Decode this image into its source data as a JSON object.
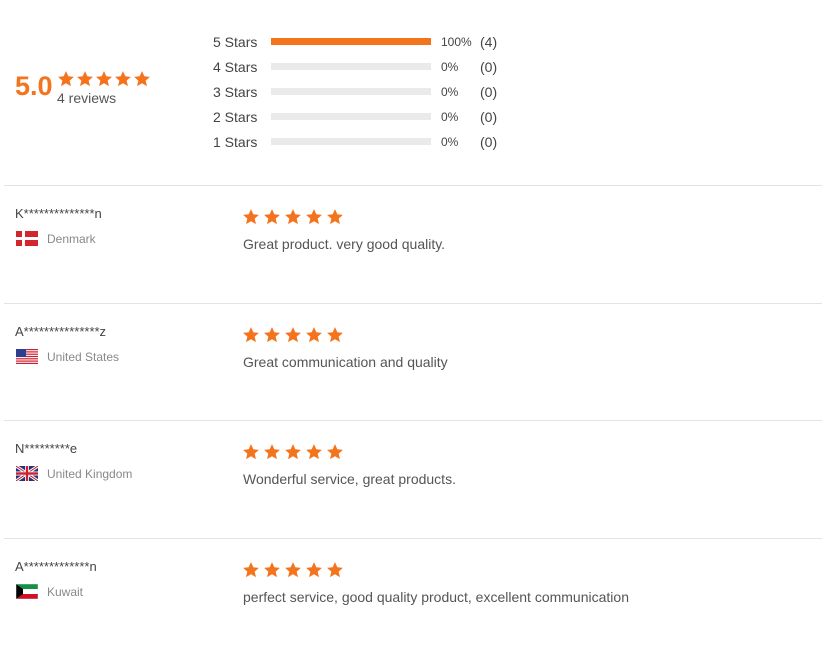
{
  "summary": {
    "score": "5.0",
    "reviews_label": "4 reviews",
    "star_rating": 5,
    "breakdown": [
      {
        "label": "5 Stars",
        "percent_text": "100%",
        "count_text": "(4)",
        "fraction": 1.0
      },
      {
        "label": "4 Stars",
        "percent_text": "0%",
        "count_text": "(0)",
        "fraction": 0
      },
      {
        "label": "3 Stars",
        "percent_text": "0%",
        "count_text": "(0)",
        "fraction": 0
      },
      {
        "label": "2 Stars",
        "percent_text": "0%",
        "count_text": "(0)",
        "fraction": 0
      },
      {
        "label": "1 Stars",
        "percent_text": "0%",
        "count_text": "(0)",
        "fraction": 0
      }
    ]
  },
  "reviews": [
    {
      "reviewer": "K**************n",
      "country": "Denmark",
      "flag_icon": "denmark-flag-icon",
      "rating": 5,
      "text": "Great product. very good quality."
    },
    {
      "reviewer": "A***************z",
      "country": "United States",
      "flag_icon": "united-states-flag-icon",
      "rating": 5,
      "text": "Great communication and quality"
    },
    {
      "reviewer": "N*********e",
      "country": "United Kingdom",
      "flag_icon": "united-kingdom-flag-icon",
      "rating": 5,
      "text": "Wonderful service, great products."
    },
    {
      "reviewer": "A*************n",
      "country": "Kuwait",
      "flag_icon": "kuwait-flag-icon",
      "rating": 5,
      "text": "perfect service, good quality product, excellent communication"
    }
  ],
  "colors": {
    "accent": "#f4731d",
    "track": "#eaeaea",
    "divider": "#e3e3e3"
  }
}
